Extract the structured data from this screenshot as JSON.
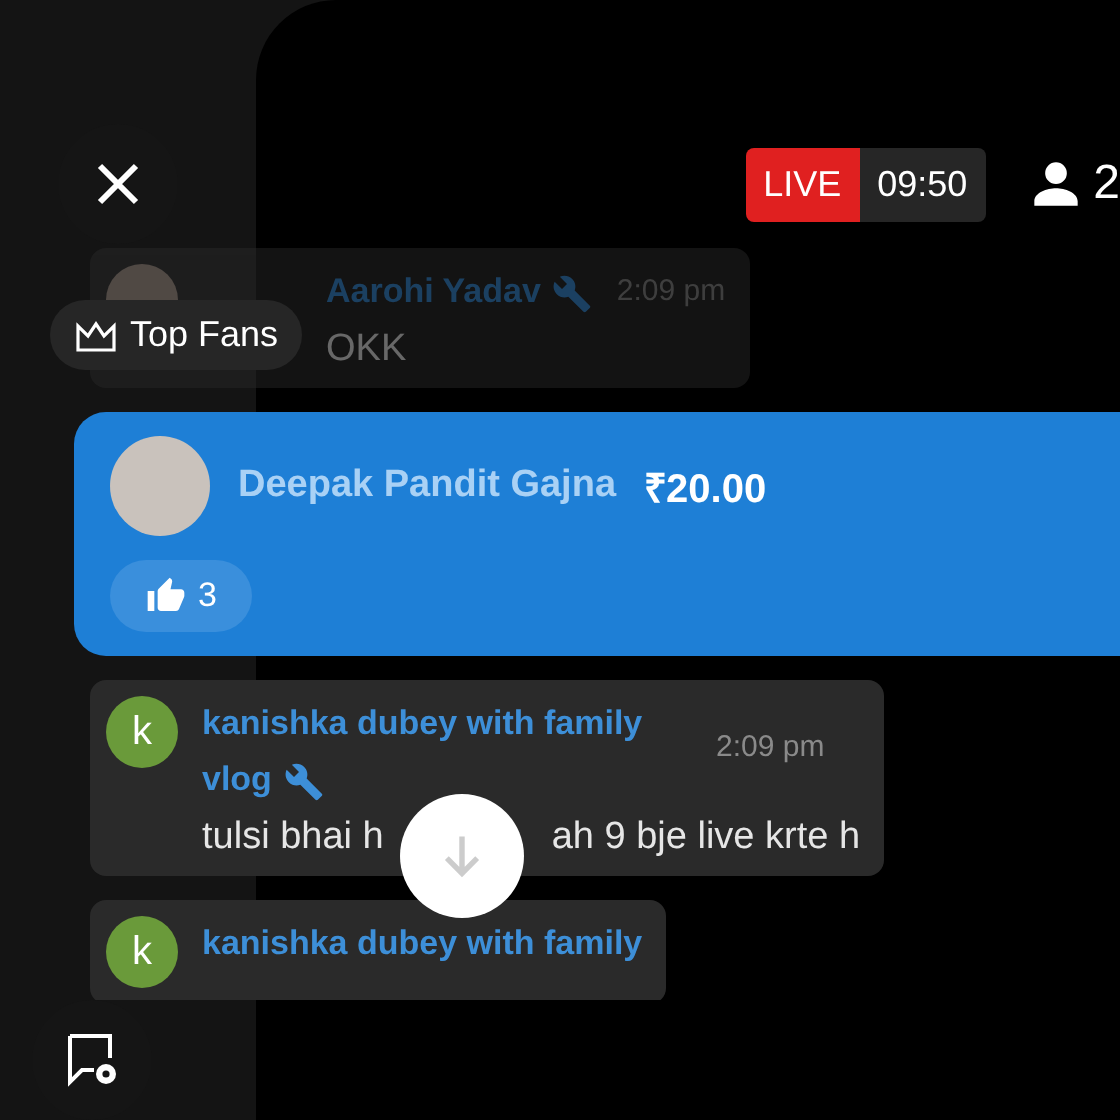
{
  "header": {
    "live_label": "LIVE",
    "duration": "09:50",
    "viewers": "2"
  },
  "top_fans": {
    "label": "Top Fans"
  },
  "messages": [
    {
      "kind": "chat",
      "faded": true,
      "author": "Aarohi Yadav",
      "moderator": true,
      "time": "2:09 pm",
      "text_parts": [
        "OKK"
      ]
    },
    {
      "kind": "super_chat",
      "author": "Deepak Pandit Gajna",
      "amount": "₹20.00",
      "likes": "3"
    },
    {
      "kind": "chat",
      "faded": false,
      "author": "kanishka dubey with family vlog",
      "moderator": true,
      "time": "2:09 pm",
      "text_parts": [
        "tulsi bhai h",
        "ah 9 bje live krte h"
      ],
      "initial": "k",
      "color": "#6a9a3a"
    },
    {
      "kind": "chat",
      "faded": false,
      "author": "kanishka dubey with family",
      "moderator": false,
      "initial": "k",
      "color": "#6a9a3a"
    }
  ]
}
